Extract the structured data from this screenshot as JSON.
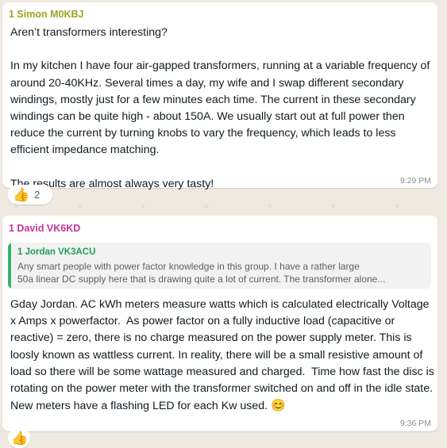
{
  "messages": [
    {
      "sender": "1 Simon M0KBJ",
      "text": "Aren’t transformers interesting?\n\nIn my kitchen I have four air-gapped transformers, running at a variable frequency of around 20-40KHz. Several times a day, my wife and I swap different secondary windings, mostly just for a few minutes each time. The current in these secondary windings can be quite high - about 150A. We usually start out at full power then reduce the current by turning knobs to vary the frequency, which leads to less efficient impedance matching.\n\nThe results are almost always very tasty!",
      "time": "9:29 PM",
      "reaction": {
        "emoji": "👍",
        "count": "2"
      }
    },
    {
      "sender": "1 David VK6KD",
      "quote": {
        "sender": "1 Jordan VK3ACU",
        "line1": "Any smart people with power factor knowledge in this group. I have a rather large",
        "line2": "50a linear DC supply here that is drawing quite a lot of current. The transformer alone..."
      },
      "text": "Gday Jordan. AC kWh meters measure watts which is calculated electrically Voltage x Amps x powerfactor.  As power factor on a fully inductive load (capacitive or reactive) = zero, there is no charge measured on the power supply meter. This is loosly known as wattless current. In reality, there will be a small resistive amount of load so there will be some wattage measured and charged.  Time how fast the disc is rotating on the power meter with the transformer switched on and off in the idle state. New meters have a flashing LED for each Kw used. ",
      "emoji": "😊",
      "time": "9:36 PM",
      "reaction": {
        "emoji": "👍"
      }
    }
  ]
}
